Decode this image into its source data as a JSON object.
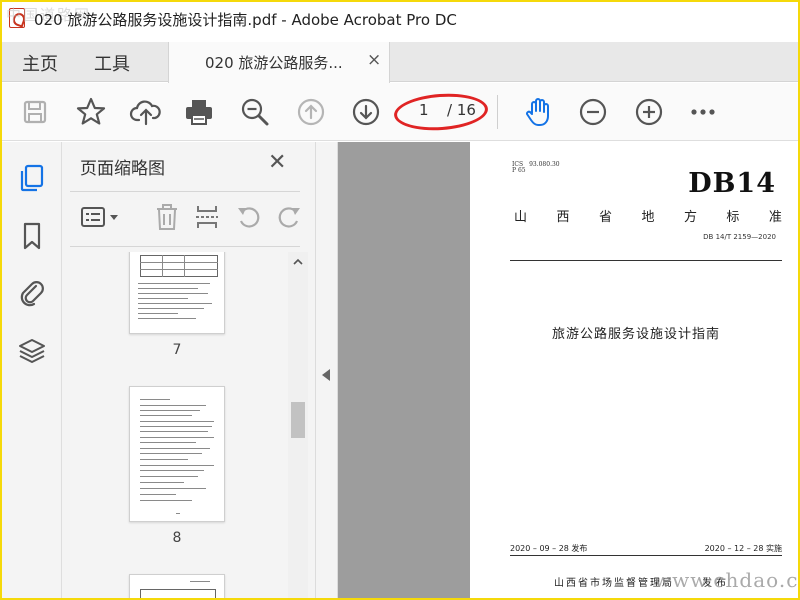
{
  "window": {
    "title": "020 旅游公路服务设施设计指南.pdf - Adobe Acrobat Pro DC",
    "watermark_top": "中国道路网"
  },
  "tabs": {
    "home": "主页",
    "tools": "工具",
    "document": "020 旅游公路服务...",
    "close": "×"
  },
  "toolbar": {
    "icons": [
      "save-icon",
      "star-icon",
      "cloud-upload-icon",
      "print-icon",
      "zoom-out-magnifier-icon",
      "previous-page-icon",
      "next-page-icon",
      "hand-icon",
      "zoom-out-icon",
      "zoom-in-icon",
      "more-icon"
    ],
    "page_current": "1",
    "page_total": "/ 16"
  },
  "left_rail": {
    "icons": [
      "page-thumbnails-icon",
      "bookmark-icon",
      "attachment-icon",
      "layers-icon"
    ]
  },
  "thumbnail_panel": {
    "title": "页面缩略图",
    "close": "✕",
    "tools": [
      "thumbnail-options-icon",
      "delete-icon",
      "insert-page-icon",
      "rotate-left-icon",
      "rotate-right-icon"
    ],
    "thumbnails": [
      {
        "label": "7"
      },
      {
        "label": "8"
      }
    ]
  },
  "document_page": {
    "ics": "ICS　93.080.30",
    "p": "P 65",
    "code": "DB14",
    "standard_chars": [
      "山",
      "西",
      "省",
      "地",
      "方",
      "标",
      "准"
    ],
    "standard_number": "DB 14/T 2159—2020",
    "title": "旅游公路服务设施设计指南",
    "published": "2020 – 09 – 28 发布",
    "implemented": "2020 – 12 – 28 实施",
    "issuer": "山西省市场监督管理局",
    "issued": "发布"
  },
  "watermark_bottom": "www.chdao.com",
  "colors": {
    "accent_blue": "#1473e6",
    "highlight_red": "#e02424",
    "frame_yellow": "#f5d90a",
    "viewport_gray": "#9d9d9d"
  }
}
